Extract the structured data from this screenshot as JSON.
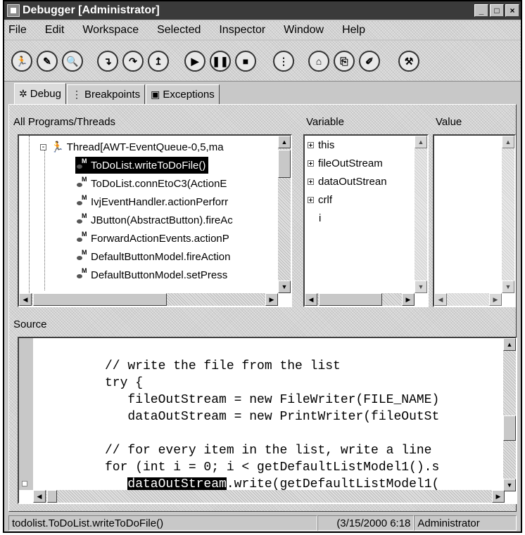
{
  "window": {
    "title": "Debugger [Administrator]",
    "controls": [
      "_",
      "□",
      "×"
    ]
  },
  "menu": [
    "File",
    "Edit",
    "Workspace",
    "Selected",
    "Inspector",
    "Window",
    "Help"
  ],
  "toolbar": {
    "buttons": [
      "run-icon",
      "pen-icon",
      "magnifier-icon",
      "step-into-icon",
      "step-over-icon",
      "step-return-icon",
      "resume-icon",
      "suspend-icon",
      "terminate-icon",
      "drop-frame-icon",
      "inspect-icon",
      "display-icon",
      "evaluate-icon",
      "wrench-icon"
    ]
  },
  "tabs": [
    {
      "label": "Debug",
      "icon": "debug-icon",
      "active": true
    },
    {
      "label": "Breakpoints",
      "icon": "breakpoints-icon",
      "active": false
    },
    {
      "label": "Exceptions",
      "icon": "exceptions-icon",
      "active": false
    }
  ],
  "threads_pane": {
    "header": "All Programs/Threads",
    "thread": "Thread[AWT-EventQueue-0,5,ma",
    "frames": [
      "ToDoList.writeToDoFile()",
      "ToDoList.connEtoC3(ActionE",
      "IvjEventHandler.actionPerforr",
      "JButton(AbstractButton).fireAc",
      "ForwardActionEvents.actionP",
      "DefaultButtonModel.fireAction",
      "DefaultButtonModel.setPress"
    ],
    "selected_index": 0
  },
  "variables_pane": {
    "header": "Variable",
    "items": [
      {
        "name": "this",
        "expandable": true
      },
      {
        "name": "fileOutStream",
        "expandable": true
      },
      {
        "name": "dataOutStrean",
        "expandable": true
      },
      {
        "name": "crlf",
        "expandable": true
      },
      {
        "name": "i",
        "expandable": false
      }
    ]
  },
  "value_pane": {
    "header": "Value"
  },
  "source_pane": {
    "header": "Source",
    "lines": [
      "// write the file from the list",
      "try {",
      "   fileOutStream = new FileWriter(FILE_NAME)",
      "   dataOutStream = new PrintWriter(fileOutSt",
      "",
      "// for every item in the list, write a line",
      "for (int i = 0; i < getDefaultListModel1().s",
      "   dataOutStream.write(getDefaultListModel1("
    ],
    "highlight_word": "dataOutStream",
    "highlight_rest": ".write(getDefaultListModel1(",
    "highlight_indent": "   "
  },
  "status": {
    "location": "todolist.ToDoList.writeToDoFile()",
    "timestamp": "(3/15/2000 6:18",
    "user": "Administrator"
  }
}
